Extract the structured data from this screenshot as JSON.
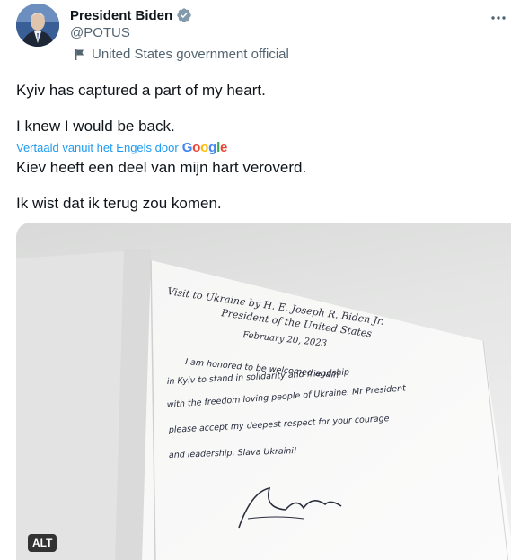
{
  "author": {
    "display_name": "President Biden",
    "handle": "@POTUS",
    "affiliation": "United States government official",
    "verified_icon": "verified-badge-icon",
    "verified_color": "#829aab"
  },
  "tweet": {
    "original_lines": [
      "Kyiv has captured a part of my heart.",
      "I knew I would be back."
    ],
    "translation_notice": "Vertaald vanuit het Engels door",
    "translation_provider": "Google",
    "translated_lines": [
      "Kiev heeft een deel van mijn hart veroverd.",
      "Ik wist dat ik terug zou komen."
    ]
  },
  "media": {
    "alt_label": "ALT",
    "note_lines": [
      "Visit to Ukraine by H. E. Joseph R. Biden Jr.",
      "President of the United States",
      "February 20, 2023",
      "I am honored to be welcomed again",
      "in Kyiv to stand in solidarity and friendship",
      "with the freedom loving people of Ukraine. Mr President",
      "please accept my deepest respect for your courage",
      "and leadership. Slava Ukraini!"
    ]
  },
  "colors": {
    "text": "#0f1419",
    "secondary": "#536471",
    "link": "#1d9bf0"
  }
}
